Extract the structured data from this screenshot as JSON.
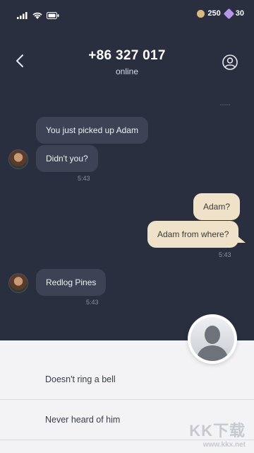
{
  "status_bar": {
    "coins": "250",
    "gems": "30",
    "icons": [
      "signal-icon",
      "wifi-icon",
      "battery-icon",
      "coin-icon",
      "gem-icon"
    ]
  },
  "header": {
    "title": "+86 327 017",
    "status": "online",
    "icons": [
      "back-arrow-icon",
      "profile-icon"
    ]
  },
  "messages": [
    {
      "text": "You just picked up Adam",
      "direction": "incoming"
    },
    {
      "text": "Didn't you?",
      "direction": "incoming",
      "time": "5:43"
    },
    {
      "text": "Adam?",
      "direction": "outgoing"
    },
    {
      "text": "Adam from where?",
      "direction": "outgoing",
      "time": "5:43"
    },
    {
      "text": "Redlog Pines",
      "direction": "incoming",
      "time": "5:43"
    }
  ],
  "replies": [
    {
      "label": "Doesn't ring a bell"
    },
    {
      "label": "Never heard of him"
    }
  ],
  "colors": {
    "background": "#2a2f40",
    "incoming_bubble": "#3d4255",
    "outgoing_bubble": "#efe2c8",
    "reply_panel": "#f3f3f6"
  },
  "watermark": {
    "logo": "KK下载",
    "url": "www.kkx.net"
  }
}
